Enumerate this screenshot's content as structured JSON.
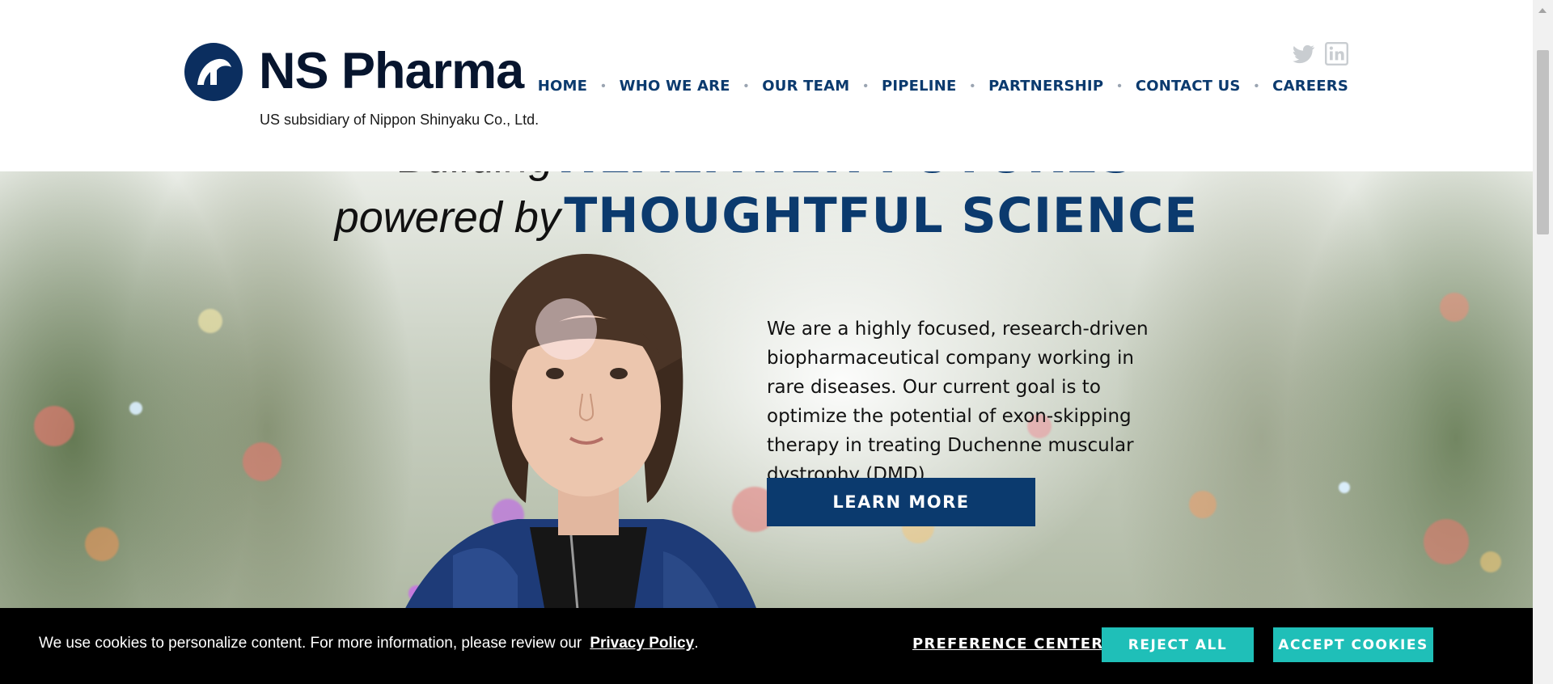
{
  "header": {
    "logo_text": "NS Pharma",
    "logo_subtitle": "US subsidiary of Nippon Shinyaku Co., Ltd.",
    "social": [
      "twitter-icon",
      "linkedin-icon"
    ],
    "nav": [
      "HOME",
      "WHO WE ARE",
      "OUR TEAM",
      "PIPELINE",
      "PARTNERSHIP",
      "CONTACT US",
      "CAREERS"
    ]
  },
  "hero": {
    "line1_italic": "Building",
    "line1_bold": "HEALTHIER FUTURES",
    "line2_italic": "powered by",
    "line2_bold": "THOUGHTFUL SCIENCE",
    "intro": "We are a highly focused, research-driven biopharmaceutical company working in rare diseases. Our current goal is to optimize the potential of exon-skipping therapy in treating Duchenne muscular dystrophy (DMD).",
    "cta": "LEARN MORE"
  },
  "cookie_bar": {
    "message": "We use cookies to personalize content. For more information, please review our",
    "policy_link": "Privacy Policy",
    "period": ".",
    "preference": "PREFERENCE CENTER",
    "reject": "REJECT ALL",
    "accept": "ACCEPT COOKIES"
  },
  "colors": {
    "brand_navy": "#0b3a6e",
    "cookie_teal": "#1fbfb8",
    "cookie_bg": "#000000"
  }
}
